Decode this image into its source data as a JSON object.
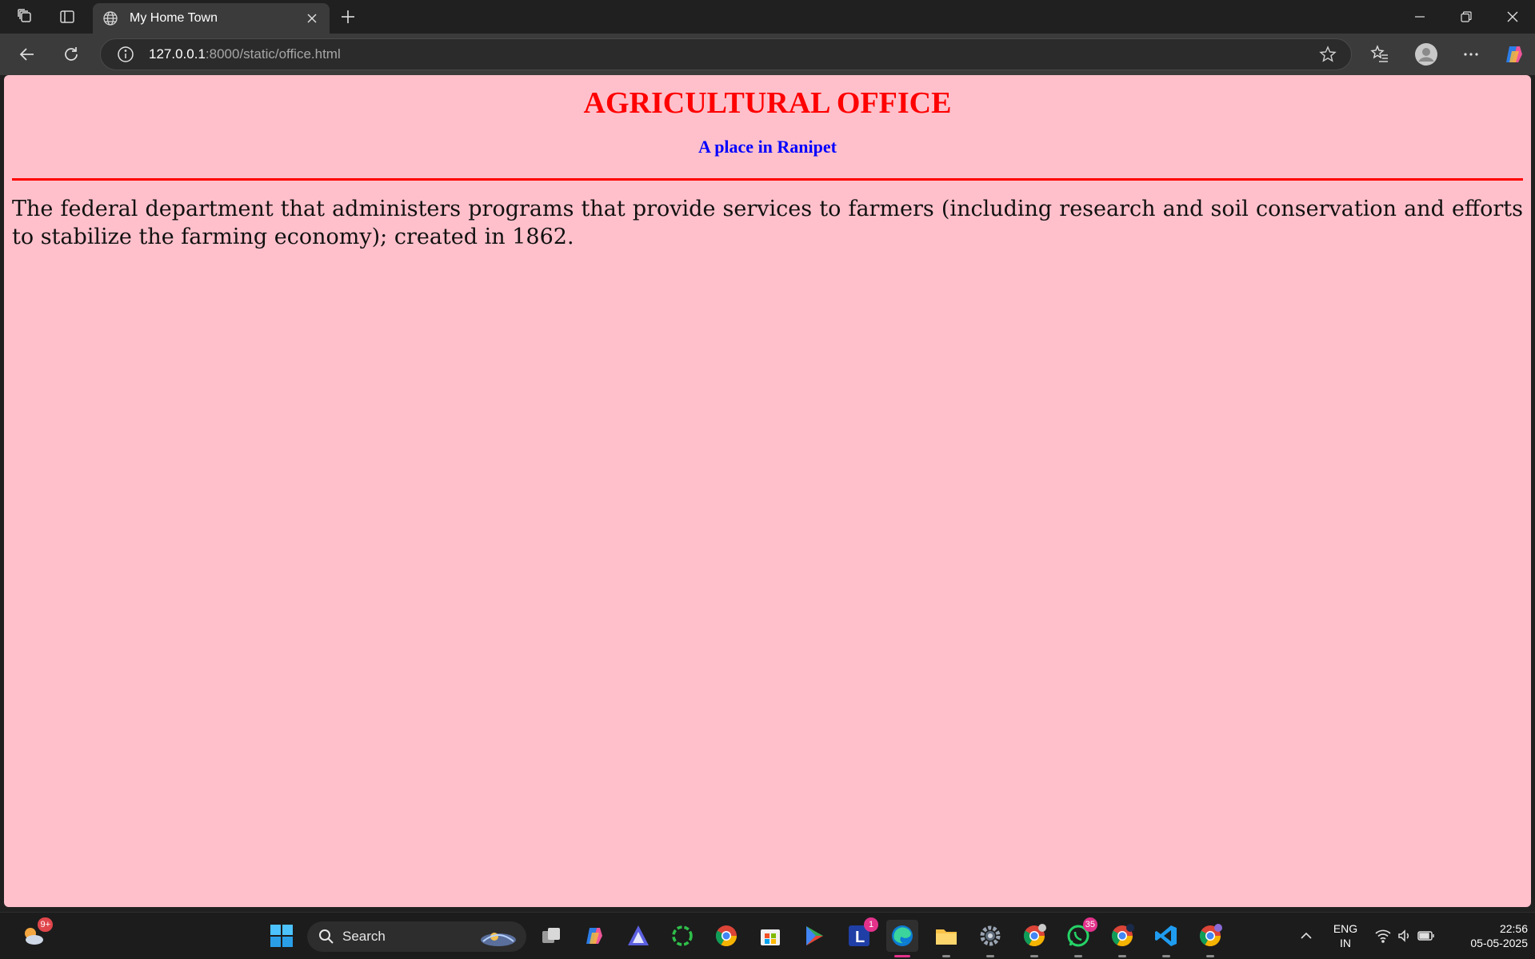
{
  "browser": {
    "tab_title": "My Home Town",
    "url_host": "127.0.0.1",
    "url_path": ":8000/static/office.html"
  },
  "page": {
    "heading": "AGRICULTURAL OFFICE",
    "subheading": "A place in Ranipet",
    "paragraph": "The federal department that administers programs that provide services to farmers (including research and soil conservation and efforts to stabilize the farming economy); created in 1862.",
    "background_color": "#ffc0cb",
    "heading_color": "#ff0000",
    "subheading_color": "#0000ff"
  },
  "taskbar": {
    "search_label": "Search",
    "weather_badge": "9+",
    "badges": {
      "letter_app": "1",
      "whatsapp": "35"
    },
    "language_line1": "ENG",
    "language_line2": "IN",
    "time": "22:56",
    "date": "05-05-2025"
  }
}
